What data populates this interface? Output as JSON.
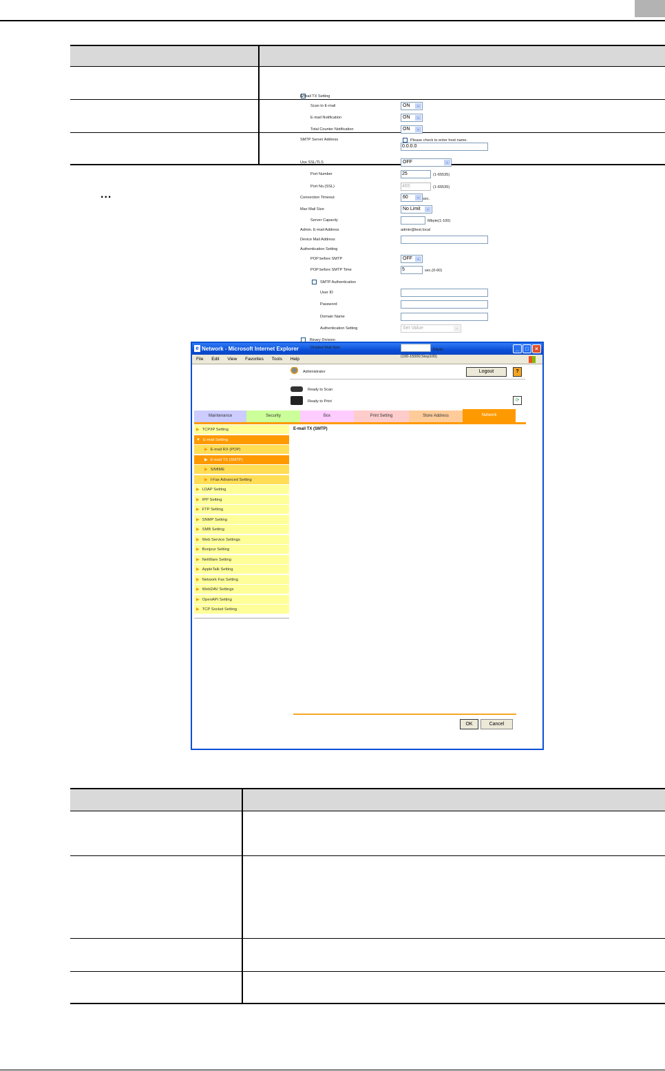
{
  "window": {
    "title": "Network - Microsoft Internet Explorer",
    "menu": [
      "File",
      "Edit",
      "View",
      "Favorites",
      "Tools",
      "Help"
    ]
  },
  "header": {
    "user": "Administrator",
    "logout": "Logout",
    "help": "?",
    "status_scan": "Ready to Scan",
    "status_print": "Ready to Print"
  },
  "tabs": [
    "Maintenance",
    "Security",
    "Box",
    "Print Setting",
    "Store Address",
    "Network"
  ],
  "tab_colors": [
    "#ccccff",
    "#ccff99",
    "#ffccff",
    "#ffcccc",
    "#ffcc99",
    "#ff9900"
  ],
  "sidebar": [
    {
      "label": "TCP/IP Setting",
      "level": 0
    },
    {
      "label": "E-mail Setting",
      "level": 0,
      "open": true
    },
    {
      "label": "E-mail RX (POP)",
      "level": 1
    },
    {
      "label": "E-mail TX (SMTP)",
      "level": 1,
      "active": true
    },
    {
      "label": "S/MIME",
      "level": 1
    },
    {
      "label": "I-Fax Advanced Setting",
      "level": 1
    },
    {
      "label": "LDAP Setting",
      "level": 0
    },
    {
      "label": "IPP Setting",
      "level": 0
    },
    {
      "label": "FTP Setting",
      "level": 0
    },
    {
      "label": "SNMP Setting",
      "level": 0
    },
    {
      "label": "SMB Setting",
      "level": 0
    },
    {
      "label": "Web Service Settings",
      "level": 0
    },
    {
      "label": "Bonjour Setting",
      "level": 0
    },
    {
      "label": "NetWare Setting",
      "level": 0
    },
    {
      "label": "AppleTalk Setting",
      "level": 0
    },
    {
      "label": "Network Fax Setting",
      "level": 0
    },
    {
      "label": "WebDAV Settings",
      "level": 0
    },
    {
      "label": "OpenAPI Setting",
      "level": 0
    },
    {
      "label": "TCP Socket Setting",
      "level": 0
    }
  ],
  "form": {
    "heading": "E-mail TX (SMTP)",
    "rows": [
      {
        "label": "E-mail TX Setting",
        "checkbox": true,
        "checked": true
      },
      {
        "label": "Scan to E-mail",
        "select": "ON"
      },
      {
        "label": "E-mail Notification",
        "select": "ON"
      },
      {
        "label": "Total Counter Notification",
        "select": "ON"
      },
      {
        "label": "SMTP Server Address",
        "check_label": "Please check to enter host name."
      },
      {
        "label": "",
        "input": "0.0.0.0"
      },
      {
        "label": "Use SSL/TLS",
        "select": "OFF"
      },
      {
        "label": "Port Number",
        "input": "25",
        "suffix": "(1-65535)"
      },
      {
        "label": "Port No.(SSL)",
        "input": "465",
        "suffix": "(1-65535)",
        "disabled": true
      },
      {
        "label": "Connection Timeout",
        "select": "60",
        "suffix": "sec."
      },
      {
        "label": "Max Mail Size",
        "select": "No Limit"
      },
      {
        "label": "Server Capacity",
        "input": "",
        "suffix": "Mbyte(1-100)"
      },
      {
        "label": "Admin. E-mail Address",
        "text": "admin@test.local"
      },
      {
        "label": "Device Mail Address",
        "input": ""
      },
      {
        "label": "Authentication Setting"
      },
      {
        "label": "POP before SMTP",
        "select": "OFF"
      },
      {
        "label": "POP before SMTP Time",
        "input": "5",
        "suffix": "sec.(0-60)"
      },
      {
        "label": "SMTP Authentication",
        "checkbox": true,
        "checked": false
      },
      {
        "label": "User ID",
        "input": ""
      },
      {
        "label": "Password",
        "input": ""
      },
      {
        "label": "Domain Name",
        "input": ""
      },
      {
        "label": "Authentication Setting",
        "select": "Set Value",
        "disabled": true
      },
      {
        "label": "Binary Division",
        "checkbox": true,
        "checked": false
      },
      {
        "label": "Divided Mail Size",
        "input": "",
        "suffix": "Kbyte",
        "note": "(100-15000;Step100)"
      }
    ],
    "ok": "OK",
    "cancel": "Cancel"
  },
  "doc": {
    "bullet": "..."
  }
}
